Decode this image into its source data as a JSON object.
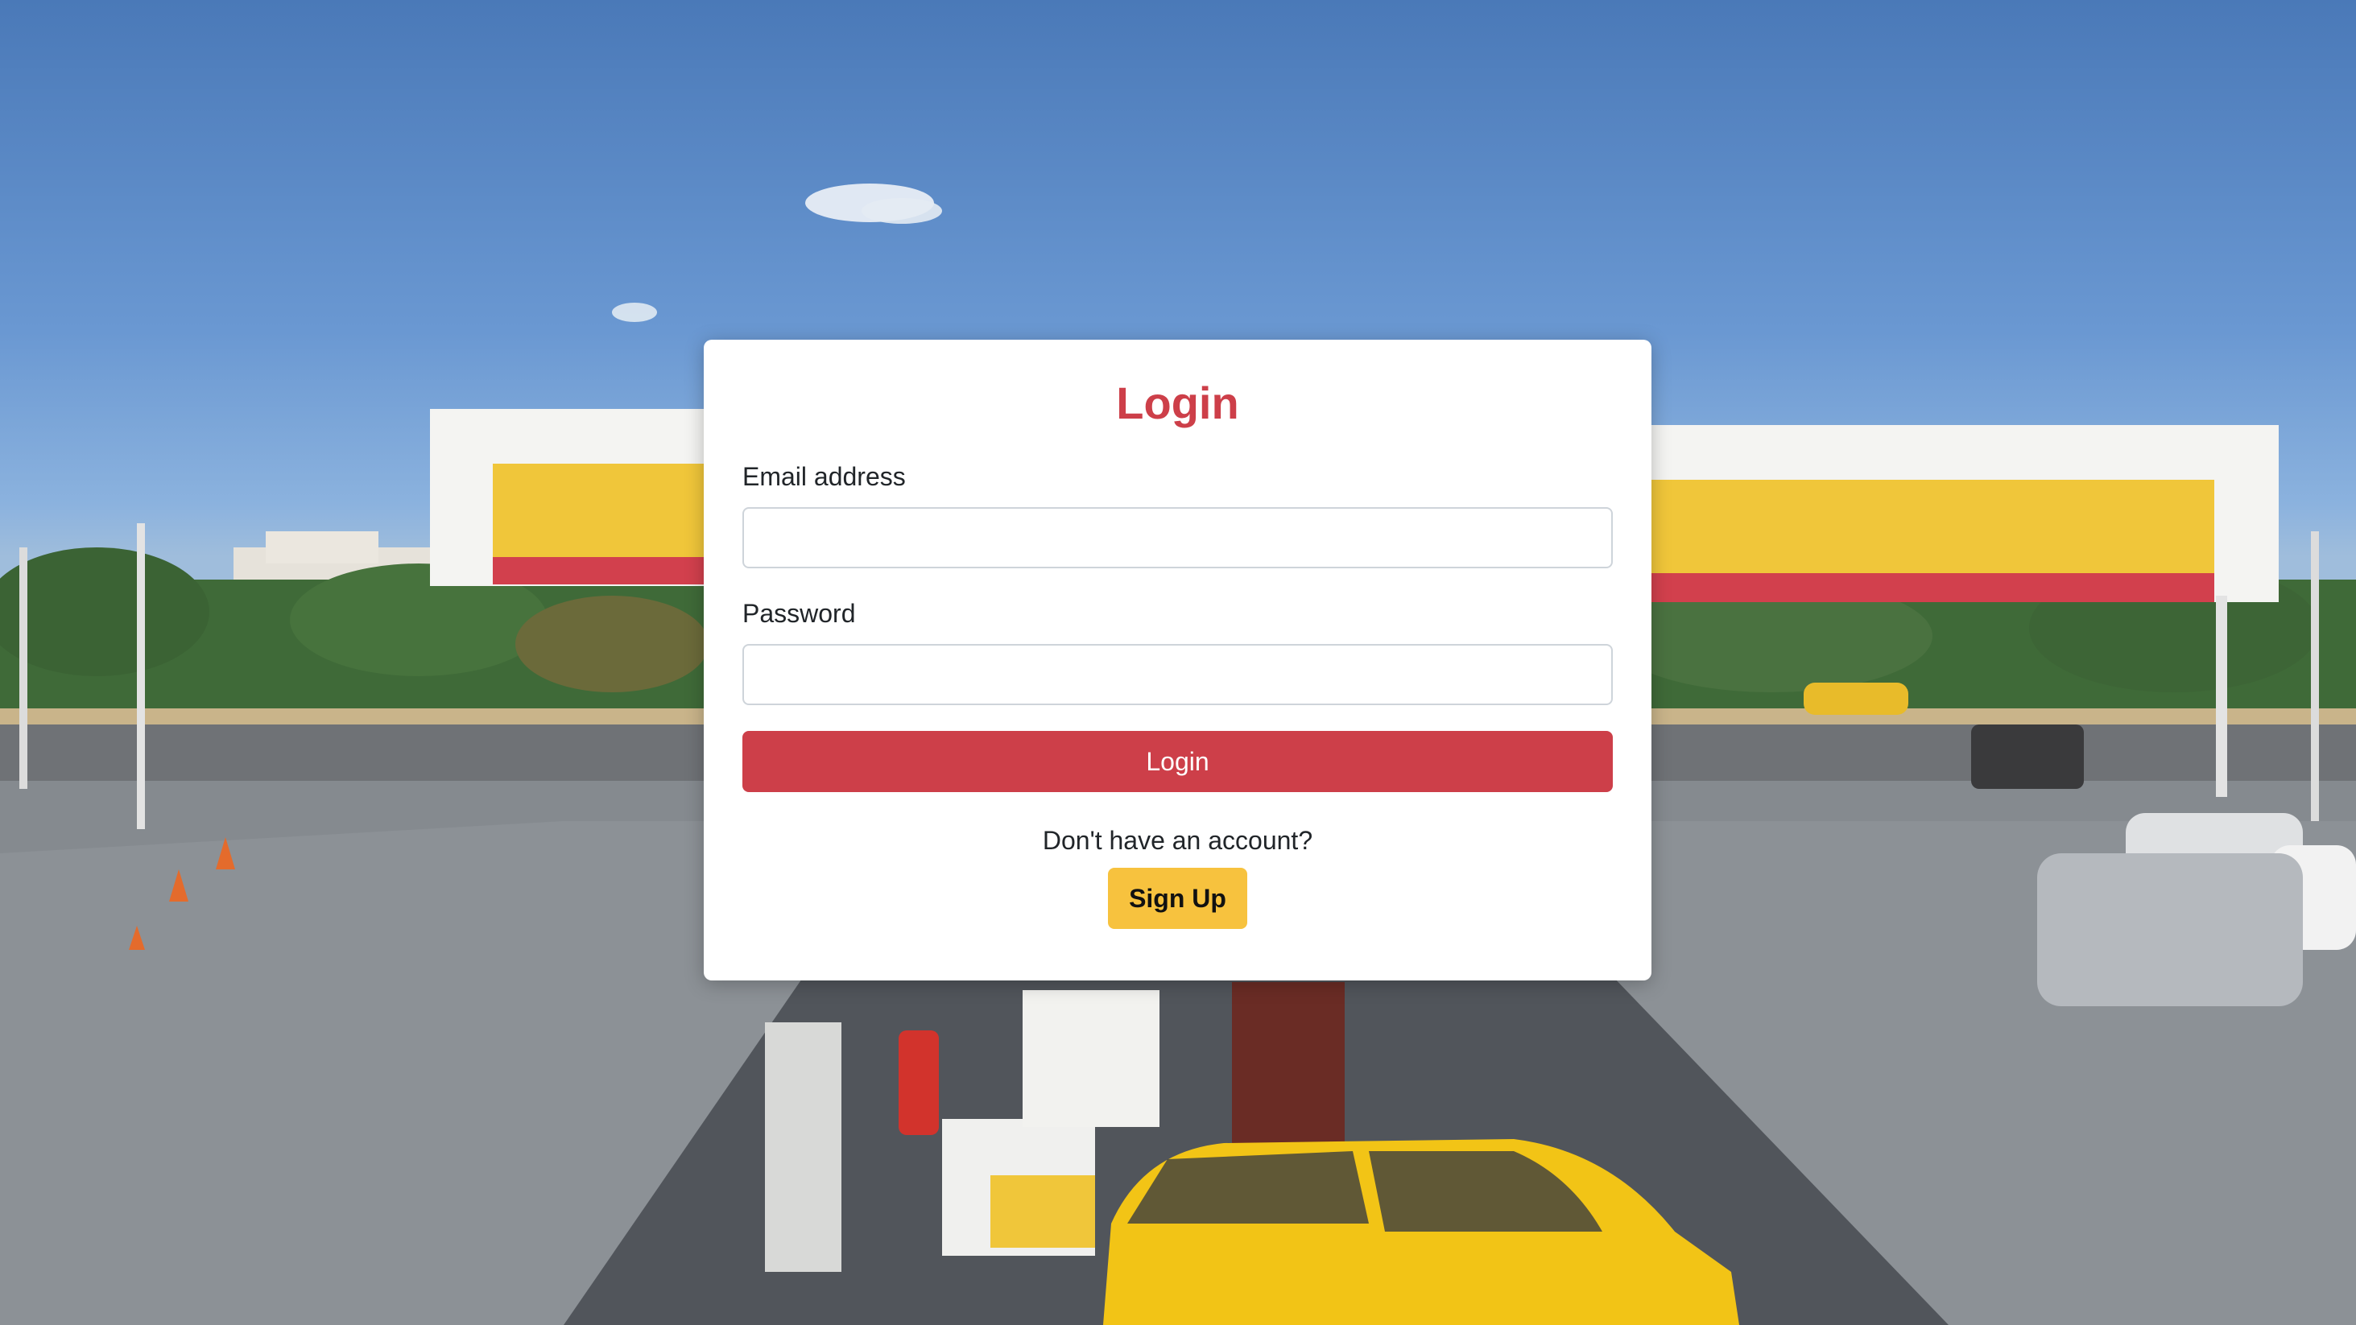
{
  "background": {
    "description_icon": "gas-station-photo",
    "colors": {
      "sky": "#4a79b8",
      "canopy_yellow": "#f0c63a",
      "canopy_red": "#d2404d",
      "asphalt": "#7f858b"
    }
  },
  "login": {
    "title": "Login",
    "email_label": "Email address",
    "email_value": "",
    "email_placeholder": "",
    "password_label": "Password",
    "password_value": "",
    "password_placeholder": "",
    "submit_label": "Login",
    "signup_prompt": "Don't have an account?",
    "signup_label": "Sign Up"
  },
  "colors": {
    "accent": "#cd3f49",
    "signup": "#f7c23e"
  }
}
